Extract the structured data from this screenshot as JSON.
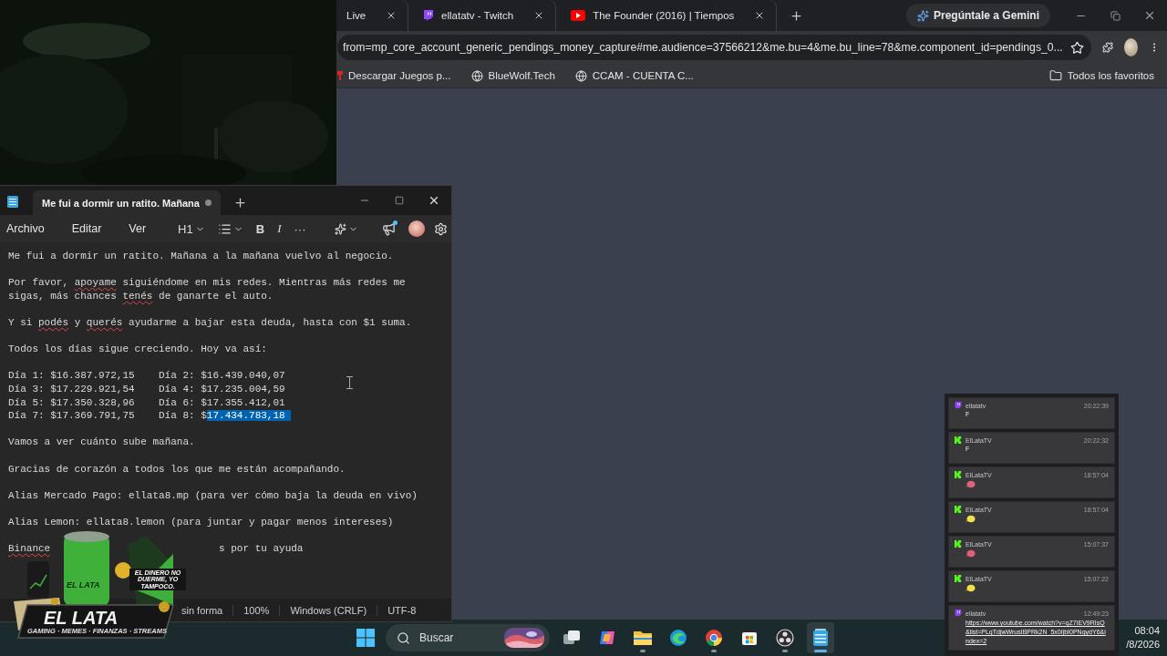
{
  "browser": {
    "tabs": [
      {
        "title": "Live",
        "selected": false
      },
      {
        "title": "ellatatv - Twitch",
        "selected": false
      },
      {
        "title": "The Founder (2016) | Tiempos",
        "selected": false
      }
    ],
    "gemini_button": "Pregúntale a Gemini",
    "address": "from=mp_core_account_generic_pendings_money_capture#me.audience=37566212&me.bu=4&me.bu_line=78&me.component_id=pendings_0...",
    "bookmarks": [
      "Descargar Juegos p...",
      "BlueWolf.Tech",
      "CCAM - CUENTA C..."
    ],
    "all_bookmarks": "Todos los favoritos"
  },
  "notepad": {
    "tab_title": "Me fui a dormir un ratito. Mañana",
    "unsaved": true,
    "menu": [
      "Archivo",
      "Editar",
      "Ver"
    ],
    "heading_button": "H1",
    "bold_button": "B",
    "italic_button": "I",
    "more_button": "···",
    "notification_dot": true,
    "paragraphs": [
      {
        "kind": "text",
        "segments": [
          {
            "kind": "plain",
            "text": "Me fui a dormir un ratito. Mañana a la mañana vuelvo al negocio."
          }
        ]
      },
      {
        "kind": "text",
        "segments": [
          {
            "kind": "plain",
            "text": "Por favor, "
          },
          {
            "kind": "misspelled",
            "text": "apoyame"
          },
          {
            "kind": "plain",
            "text": " siguiéndome en mis redes. Mientras más redes me sigas, más chances "
          },
          {
            "kind": "misspelled",
            "text": "tenés"
          },
          {
            "kind": "plain",
            "text": " de ganarte el auto."
          }
        ]
      },
      {
        "kind": "text",
        "segments": [
          {
            "kind": "plain",
            "text": "Y si "
          },
          {
            "kind": "misspelled",
            "text": "podés"
          },
          {
            "kind": "plain",
            "text": " y "
          },
          {
            "kind": "misspelled",
            "text": "querés"
          },
          {
            "kind": "plain",
            "text": " ayudarme a bajar esta deuda, hasta con $1 suma."
          }
        ]
      },
      {
        "kind": "text",
        "segments": [
          {
            "kind": "plain",
            "text": "Todos los días sigue creciendo. Hoy va así:"
          }
        ]
      },
      {
        "kind": "days",
        "entries": [
          {
            "segments": [
              {
                "kind": "plain",
                "text": "Día 1: $16.387.972,15"
              }
            ]
          },
          {
            "segments": [
              {
                "kind": "plain",
                "text": "Día 2: $16.439.040,07"
              }
            ]
          },
          {
            "segments": [
              {
                "kind": "plain",
                "text": "Día 3: $17.229.921,54"
              }
            ]
          },
          {
            "segments": [
              {
                "kind": "plain",
                "text": "Día 4: $17.235.004,59"
              }
            ]
          },
          {
            "segments": [
              {
                "kind": "plain",
                "text": "Día 5: $17.350.328,96"
              }
            ]
          },
          {
            "segments": [
              {
                "kind": "plain",
                "text": "Día 6: $17.355.412,01"
              }
            ]
          },
          {
            "segments": [
              {
                "kind": "plain",
                "text": "Día 7: $17.369.791,75"
              }
            ]
          },
          {
            "segments": [
              {
                "kind": "plain",
                "text": "Día 8: $"
              },
              {
                "kind": "selected",
                "text": "17.434.783,18"
              }
            ]
          }
        ]
      },
      {
        "kind": "text",
        "segments": [
          {
            "kind": "plain",
            "text": "Vamos a ver cuánto sube mañana."
          }
        ]
      },
      {
        "kind": "text",
        "segments": [
          {
            "kind": "plain",
            "text": "Gracias de corazón a todos los que me están acompañando."
          }
        ]
      },
      {
        "kind": "text",
        "segments": [
          {
            "kind": "plain",
            "text": "Alias Mercado Pago: ellata8.mp (para ver cómo baja la deuda en vivo)"
          }
        ]
      },
      {
        "kind": "text",
        "segments": [
          {
            "kind": "plain",
            "text": "Alias Lemon: ellata8.lemon (para juntar y pagar menos intereses)"
          }
        ]
      },
      {
        "kind": "covered",
        "before": [
          {
            "kind": "misspelled",
            "text": "Binance"
          }
        ],
        "after": [
          {
            "kind": "plain",
            "text": "s por tu ayuda"
          }
        ]
      }
    ],
    "status": [
      "sin forma",
      "100%",
      "Windows (CRLF)",
      "UTF-8"
    ]
  },
  "chat": [
    {
      "kind": "twitch",
      "user": "ellatatv",
      "time": "20:22:39",
      "text": "F"
    },
    {
      "kind": "kick",
      "user": "ElLataTV",
      "time": "20:22:32",
      "text": "F"
    },
    {
      "kind": "kick",
      "user": "ElLataTV",
      "time": "18:57:04",
      "color": "#e0607a"
    },
    {
      "kind": "kick",
      "user": "ElLataTV",
      "time": "18:57:04",
      "color": "#f2e04a"
    },
    {
      "kind": "kick",
      "user": "ElLataTV",
      "time": "15:07:37",
      "color": "#e0607a"
    },
    {
      "kind": "kick",
      "user": "ElLataTV",
      "time": "15:07:22",
      "color": "#f2e04a"
    },
    {
      "kind": "twitch",
      "user": "ellatatv",
      "time": "12:49:23",
      "link": "https://www.youtube.com/watch?v=qZ7IEV9RIsQ&list=PLqTdjwWrusIBPRk2N_5x0IjbI0PNgydY6&index=2"
    }
  ],
  "logo": {
    "can_label": "EL LATA",
    "tagline": "EL DINERO NO DUERME, YO TAMPOCO.",
    "title": "EL LATA",
    "footer": "GAMING · MEMES · FINANZAS · STREAMS"
  },
  "taskbar": {
    "search_placeholder": "Buscar",
    "apps": [
      {
        "running": false,
        "selected": false
      },
      {
        "running": false,
        "selected": false
      },
      {
        "running": true,
        "selected": false
      },
      {
        "running": false,
        "selected": false
      },
      {
        "running": true,
        "selected": false
      },
      {
        "running": false,
        "selected": false
      },
      {
        "running": true,
        "selected": false
      },
      {
        "running": true,
        "selected": true
      }
    ],
    "time": "08:04",
    "date": "/8/2026"
  }
}
